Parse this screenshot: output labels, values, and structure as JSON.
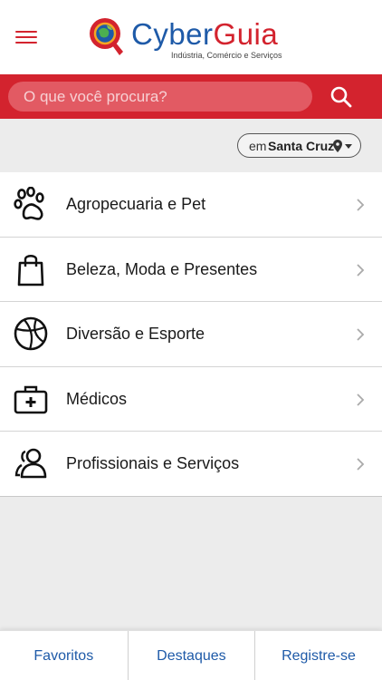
{
  "header": {
    "menu_icon": "hamburger-menu-icon",
    "logo": {
      "name_part1": "Cyber",
      "name_part2": "Guia",
      "tagline": "Indústria, Comércio e Serviços",
      "brand_blue": "#1e5aa8",
      "brand_red": "#d3232e"
    }
  },
  "search": {
    "placeholder": "O que você procura?",
    "value": "",
    "icon": "search-icon",
    "bar_color": "#d3232e"
  },
  "location": {
    "prefix": "em",
    "city": "Santa Cruz",
    "icon": "map-pin-icon"
  },
  "categories": [
    {
      "label": "Agropecuaria e Pet",
      "icon": "paw-icon"
    },
    {
      "label": "Beleza, Moda e Presentes",
      "icon": "shopping-bag-icon"
    },
    {
      "label": "Diversão e Esporte",
      "icon": "basketball-icon"
    },
    {
      "label": "Médicos",
      "icon": "medical-kit-icon"
    },
    {
      "label": "Profissionais e Serviços",
      "icon": "users-icon"
    }
  ],
  "bottom_nav": {
    "tabs": [
      {
        "label": "Favoritos"
      },
      {
        "label": "Destaques"
      },
      {
        "label": "Registre-se"
      }
    ],
    "link_color": "#1e5aa8"
  }
}
